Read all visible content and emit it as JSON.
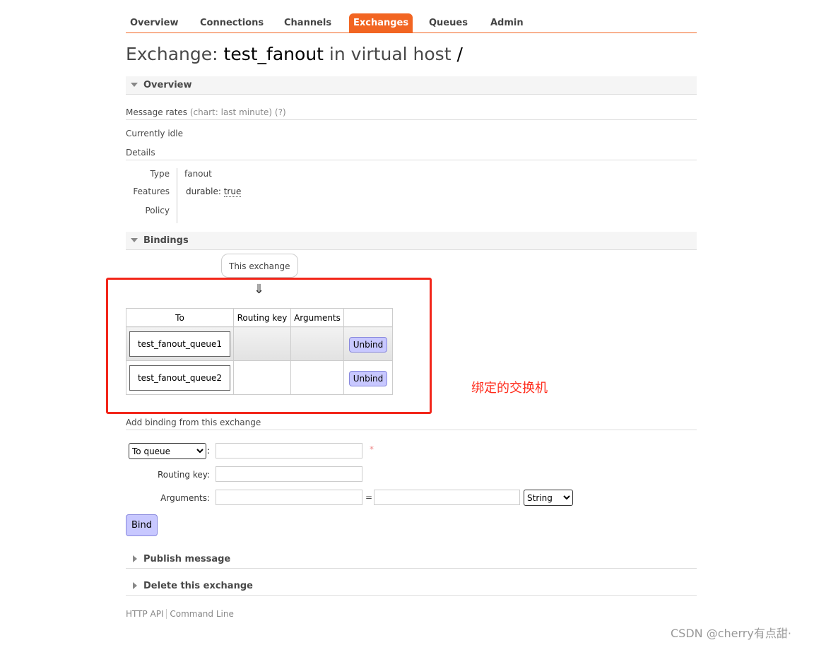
{
  "nav": {
    "tabs": [
      "Overview",
      "Connections",
      "Channels",
      "Exchanges",
      "Queues",
      "Admin"
    ],
    "active": "Exchanges"
  },
  "title": {
    "prefix": "Exchange:",
    "name": "test_fanout",
    "middle": "in virtual host",
    "vhost": "/"
  },
  "overview": {
    "header": "Overview",
    "rates_label": "Message rates",
    "rates_note": "(chart: last minute) (?)",
    "idle": "Currently idle",
    "details": "Details",
    "type_label": "Type",
    "type": "fanout",
    "features_label": "Features",
    "feature_key": "durable:",
    "feature_val": "true",
    "policy_label": "Policy"
  },
  "bindings": {
    "header": "Bindings",
    "source": "This exchange",
    "arrow": "⇓",
    "columns": [
      "To",
      "Routing key",
      "Arguments",
      ""
    ],
    "rows": [
      {
        "to": "test_fanout_queue1",
        "routing_key": "",
        "arguments": "",
        "action": "Unbind"
      },
      {
        "to": "test_fanout_queue2",
        "routing_key": "",
        "arguments": "",
        "action": "Unbind"
      }
    ]
  },
  "annotation": {
    "text": "绑定的交换机",
    "color": "#ff2a1a"
  },
  "add_binding": {
    "header": "Add binding from this exchange",
    "dest_type": "To queue",
    "required": "*",
    "routing_key_label": "Routing key:",
    "arguments_label": "Arguments:",
    "eq": "=",
    "arg_type": "String",
    "bind": "Bind"
  },
  "publish": {
    "header": "Publish message"
  },
  "delete": {
    "header": "Delete this exchange"
  },
  "footer": {
    "http_api": "HTTP API",
    "cli": "Command Line"
  },
  "watermark": "CSDN @cherry有点甜·",
  "colors": {
    "accent": "#f26522",
    "button": "#c8c8ff"
  }
}
